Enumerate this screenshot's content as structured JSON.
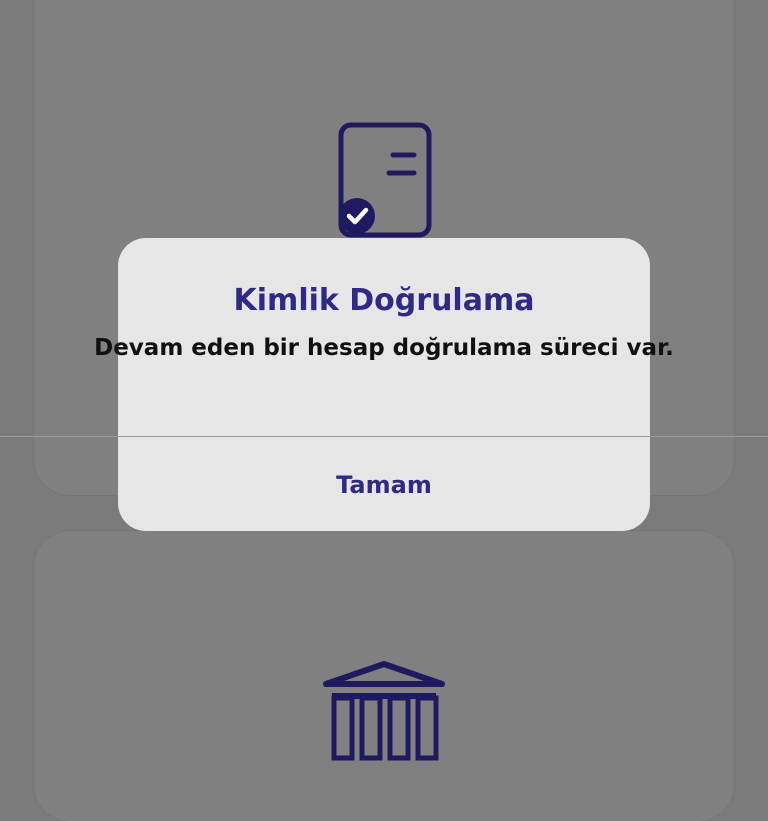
{
  "background": {
    "color": "#7b7b7b",
    "card_color": "#808080",
    "icons": {
      "top": "document-check-icon",
      "bottom": "bank-building-icon"
    }
  },
  "alert": {
    "title": "Kimlik Doğrulama",
    "message": "Devam eden bir hesap doğrulama süreci var.",
    "button_label": "Tamam",
    "title_color": "#2f2a85",
    "text_color": "#111111",
    "button_color": "#2f2a85",
    "background": "#e6e6e6"
  }
}
